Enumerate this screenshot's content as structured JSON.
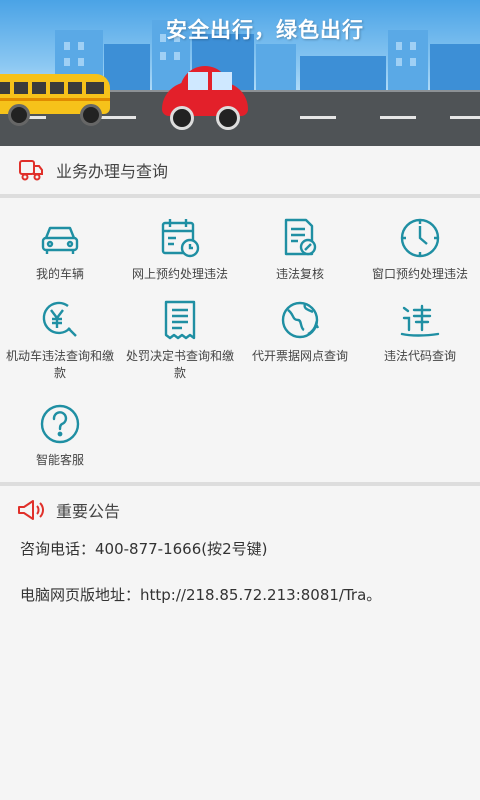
{
  "banner": {
    "slogan": "安全出行，绿色出行"
  },
  "services": {
    "header_icon": "truck-icon",
    "title": "业务办理与查询",
    "items": [
      {
        "label": "我的车辆",
        "icon": "car-icon"
      },
      {
        "label": "网上预约处理违法",
        "icon": "calendar-clock-icon"
      },
      {
        "label": "违法复核",
        "icon": "document-edit-icon"
      },
      {
        "label": "窗口预约处理违法",
        "icon": "clock-icon"
      },
      {
        "label": "机动车违法查询和缴款",
        "icon": "yen-search-icon"
      },
      {
        "label": "处罚决定书查询和缴款",
        "icon": "receipt-icon"
      },
      {
        "label": "代开票据网点查询",
        "icon": "globe-refresh-icon"
      },
      {
        "label": "违法代码查询",
        "icon": "violation-code-icon"
      },
      {
        "label": "智能客服",
        "icon": "question-icon"
      }
    ]
  },
  "notice": {
    "header_icon": "megaphone-icon",
    "title": "重要公告",
    "phone_line": "咨询电话：400-877-1666(按2号键)",
    "web_line": "电脑网页版地址：http://218.85.72.213:8081/Tra。"
  },
  "colors": {
    "icon_teal": "#1f8fa3",
    "accent_red": "#e0302a"
  }
}
